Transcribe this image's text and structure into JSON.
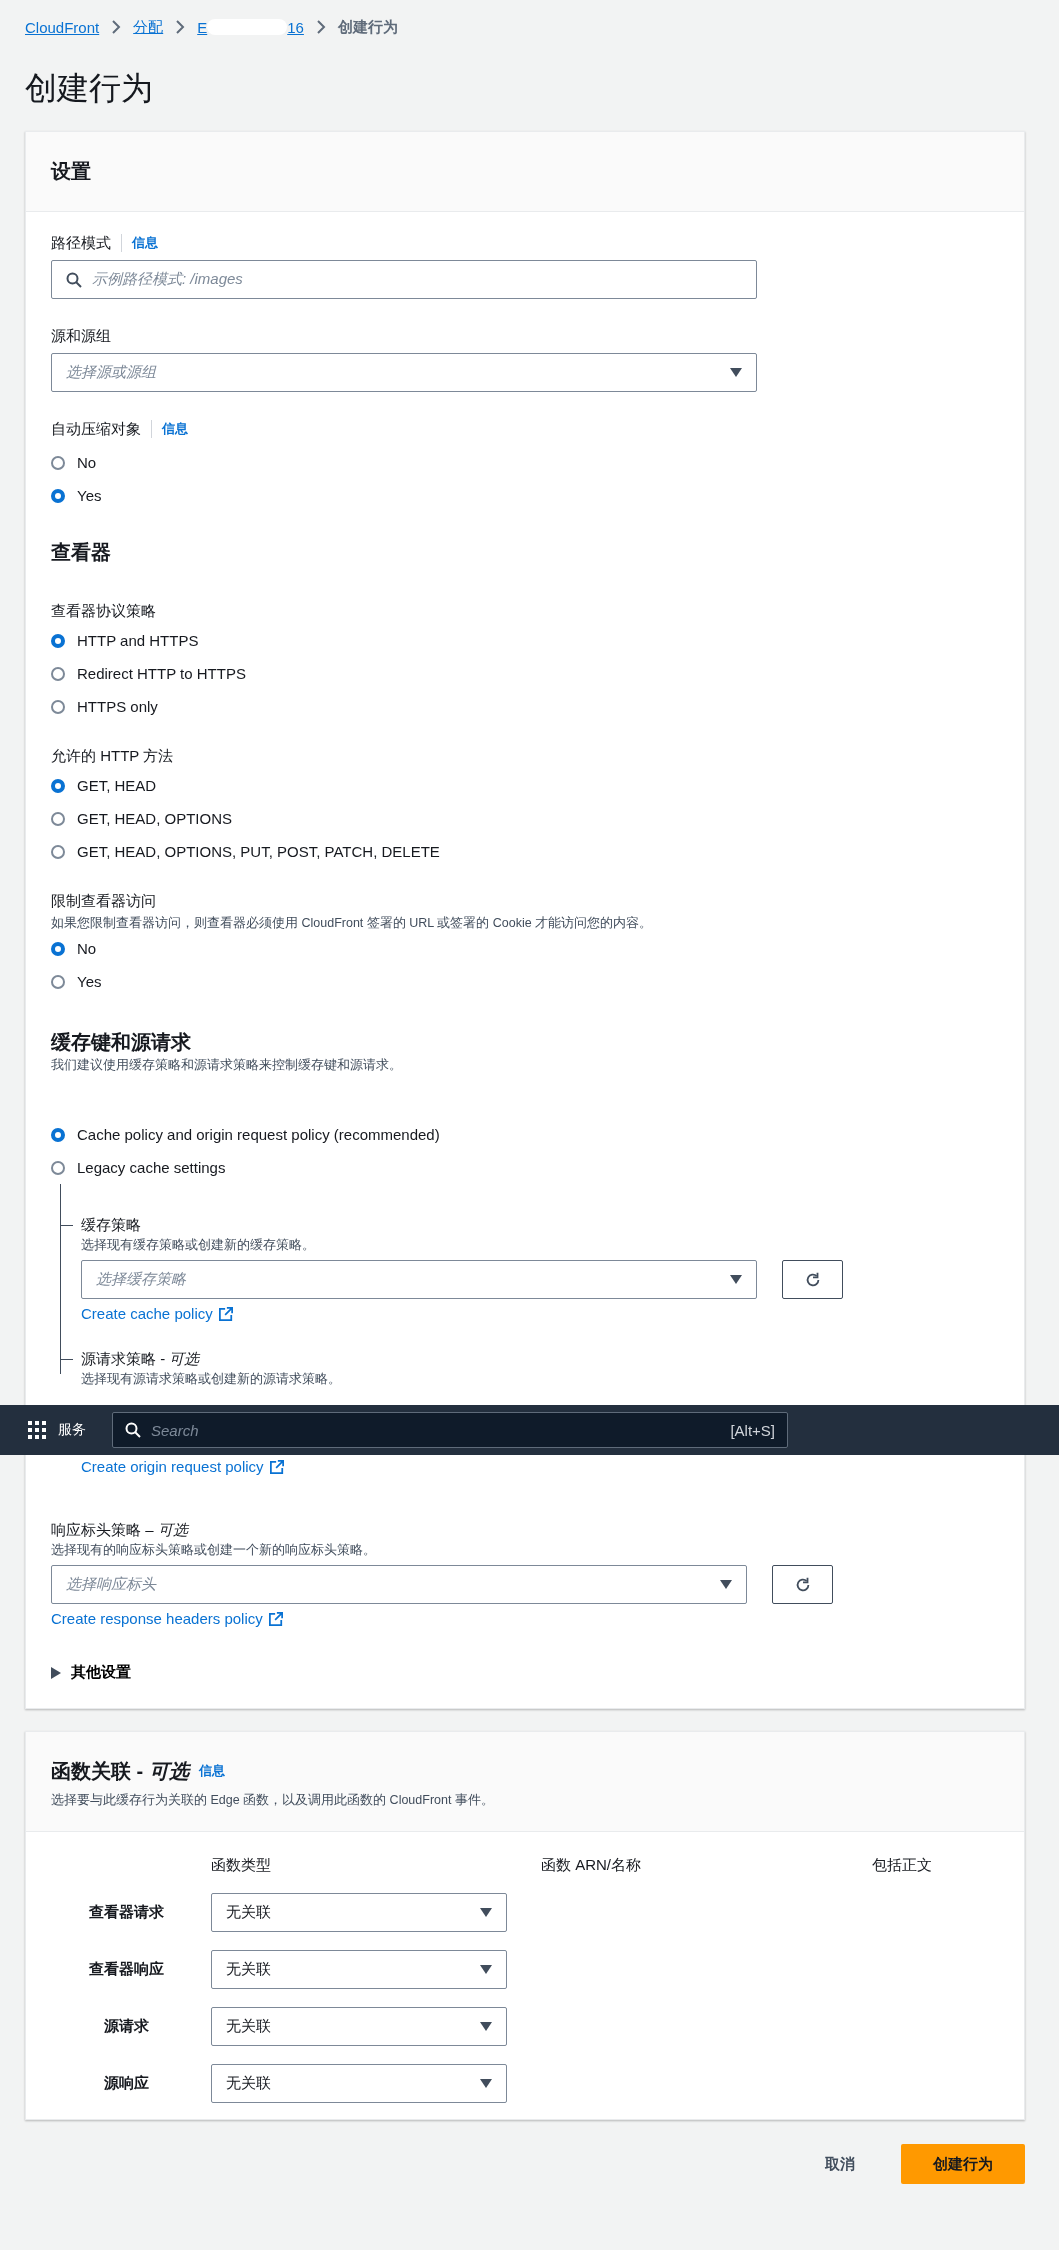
{
  "breadcrumb": [
    {
      "kind": "link",
      "label": "CloudFront"
    },
    {
      "kind": "link",
      "label": "分配"
    },
    {
      "kind": "redacted_link",
      "label_start": "E",
      "label_end": "16"
    },
    {
      "kind": "current",
      "label": "创建行为"
    }
  ],
  "page_title": "创建行为",
  "settings_panel": {
    "title": "设置",
    "path_pattern": {
      "label": "路径模式",
      "info": "信息",
      "placeholder": "示例路径模式: /images"
    },
    "origin": {
      "label": "源和源组",
      "placeholder": "选择源或源组"
    },
    "compress": {
      "label": "自动压缩对象",
      "info": "信息",
      "options": [
        {
          "label": "No",
          "selected": false
        },
        {
          "label": "Yes",
          "selected": true
        }
      ]
    },
    "viewer": {
      "heading": "查看器",
      "groups": [
        {
          "label": "查看器协议策略",
          "options": [
            {
              "label": "HTTP and HTTPS",
              "selected": true
            },
            {
              "label": "Redirect HTTP to HTTPS",
              "selected": false
            },
            {
              "label": "HTTPS only",
              "selected": false
            }
          ]
        },
        {
          "label": "允许的 HTTP 方法",
          "options": [
            {
              "label": "GET, HEAD",
              "selected": true
            },
            {
              "label": "GET, HEAD, OPTIONS",
              "selected": false
            },
            {
              "label": "GET, HEAD, OPTIONS, PUT, POST, PATCH, DELETE",
              "selected": false
            }
          ]
        },
        {
          "label": "限制查看器访问",
          "description": "如果您限制查看器访问，则查看器必须使用 CloudFront 签署的 URL 或签署的 Cookie 才能访问您的内容。",
          "options": [
            {
              "label": "No",
              "selected": true
            },
            {
              "label": "Yes",
              "selected": false
            }
          ]
        }
      ]
    },
    "cache": {
      "heading": "缓存键和源请求",
      "description": "我们建议使用缓存策略和源请求策略来控制缓存键和源请求。",
      "options": [
        {
          "label": "Cache policy and origin request policy (recommended)",
          "selected": true
        },
        {
          "label": "Legacy cache settings",
          "selected": false
        }
      ],
      "cache_policy": {
        "label": "缓存策略",
        "description": "选择现有缓存策略或创建新的缓存策略。",
        "placeholder": "选择缓存策略",
        "link": "Create cache policy"
      },
      "origin_request_policy": {
        "label": "源请求策略 - *可选*",
        "description": "选择现有源请求策略或创建新的源请求策略。",
        "link": "Create origin request policy"
      }
    },
    "response_headers": {
      "label": "响应标头策略 – *可选*",
      "description": "选择现有的响应标头策略或创建一个新的响应标头策略。",
      "placeholder": "选择响应标头",
      "link": "Create response headers policy"
    },
    "more_settings": {
      "label": "其他设置",
      "expanded": false
    }
  },
  "function_panel": {
    "title": "函数关联 - *可选*",
    "info": "信息",
    "description": "选择要与此缓存行为关联的 Edge 函数，以及调用此函数的 CloudFront 事件。",
    "columns": [
      "函数类型",
      "函数 ARN/名称",
      "包括正文"
    ],
    "rows": [
      {
        "event": "查看器请求",
        "function_type": "无关联"
      },
      {
        "event": "查看器响应",
        "function_type": "无关联"
      },
      {
        "event": "源请求",
        "function_type": "无关联"
      },
      {
        "event": "源响应",
        "function_type": "无关联"
      }
    ]
  },
  "footer": {
    "cancel": "取消",
    "submit": "创建行为"
  },
  "top_bar": {
    "services": "服务",
    "search_placeholder": "Search",
    "shortcut": "[Alt+S]"
  }
}
